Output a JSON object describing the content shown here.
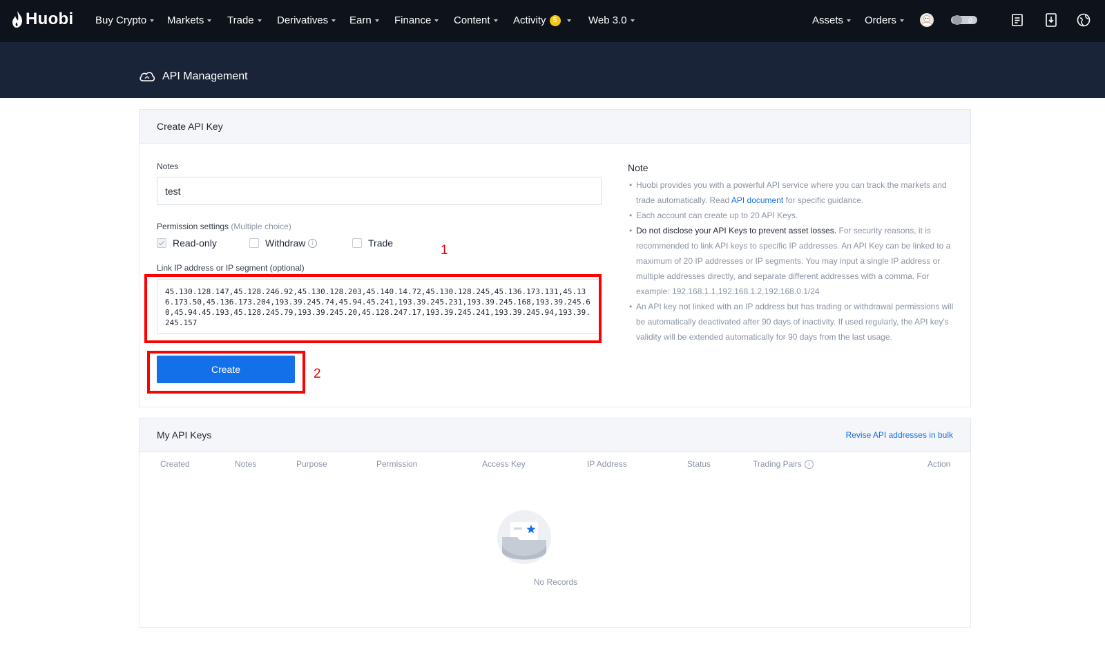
{
  "nav": {
    "brand": "Huobi",
    "items": [
      {
        "label": "Buy Crypto"
      },
      {
        "label": "Markets"
      },
      {
        "label": "Trade"
      },
      {
        "label": "Derivatives"
      },
      {
        "label": "Earn"
      },
      {
        "label": "Finance"
      },
      {
        "label": "Content"
      },
      {
        "label": "Activity",
        "badge": "5"
      },
      {
        "label": "Web 3.0"
      }
    ],
    "right": [
      {
        "label": "Assets"
      },
      {
        "label": "Orders"
      }
    ],
    "toggle_value": "0",
    "icons": [
      "avatar-icon",
      "toggle-icon",
      "orders-list-icon",
      "download-icon",
      "language-icon"
    ]
  },
  "banner": {
    "title": "API Management",
    "icon": "cloud-icon"
  },
  "create": {
    "header": "Create API Key",
    "notes_label": "Notes",
    "notes_value": "test",
    "permission_label": "Permission settings",
    "permission_hint": "(Multiple choice)",
    "permissions": [
      {
        "label": "Read-only",
        "checked": true
      },
      {
        "label": "Withdraw",
        "checked": false
      },
      {
        "label": "Trade",
        "checked": false
      }
    ],
    "ip_label": "Link IP address or IP segment (optional)",
    "ip_value": "45.130.128.147,45.128.246.92,45.130.128.203,45.140.14.72,45.130.128.245,45.136.173.131,45.136.173.50,45.136.173.204,193.39.245.74,45.94.45.241,193.39.245.231,193.39.245.168,193.39.245.60,45.94.45.193,45.128.245.79,193.39.245.20,45.128.247.17,193.39.245.241,193.39.245.94,193.39.245.157",
    "create_button": "Create",
    "annotation_1": "1",
    "annotation_2": "2",
    "annotation_color": "#ff0000"
  },
  "note": {
    "title": "Note",
    "item1_pre": "Huobi provides you with a powerful API service where you can track the markets and trade automatically. Read ",
    "item1_link": "API document",
    "item1_post": " for specific guidance.",
    "item2": "Each account can create up to 20 API Keys.",
    "item3_bold": "Do not disclose your API Keys to prevent asset losses.",
    "item3_rest": " For security reasons, it is recommended to link API keys to specific IP addresses. An API Key can be linked to a maximum of 20 IP addresses or IP segments. You may input a single IP address or multiple addresses directly, and separate different addresses with a comma. For example: 192.168.1.1,192.168.1.2,192.168.0.1/24",
    "item4": "An API key not linked with an IP address but has trading or withdrawal permissions will be automatically deactivated after 90 days of inactivity. If used regularly, the API key's validity will be extended automatically for 90 days from the last usage."
  },
  "keys": {
    "header": "My API Keys",
    "revise_link": "Revise API addresses in bulk",
    "columns": [
      "Created",
      "Notes",
      "Purpose",
      "Permission",
      "Access Key",
      "IP Address",
      "Status",
      "Trading Pairs",
      "Action"
    ],
    "empty": "No Records"
  },
  "colors": {
    "nav_bg": "#0e121b",
    "banner_bg": "#1a2438",
    "primary": "#1470e8",
    "coin": "#f5c518"
  }
}
